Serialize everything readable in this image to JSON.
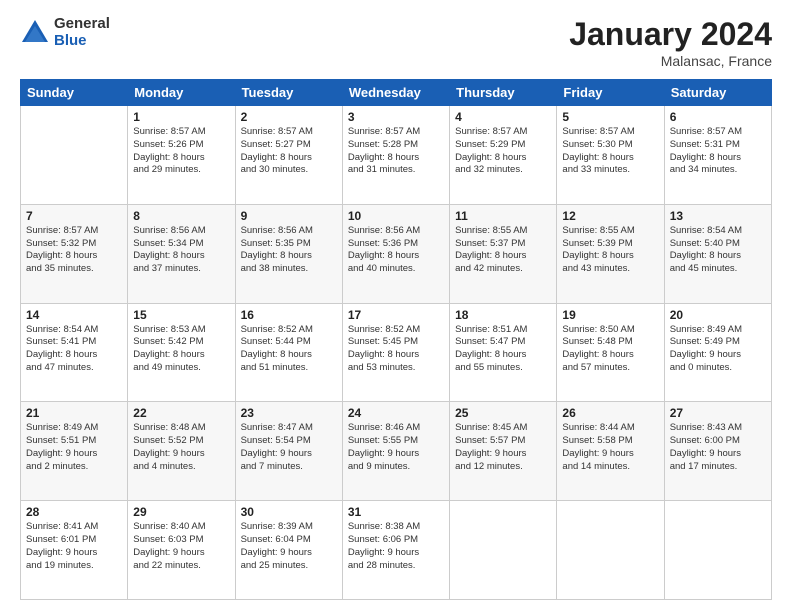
{
  "header": {
    "logo_general": "General",
    "logo_blue": "Blue",
    "title": "January 2024",
    "location": "Malansac, France"
  },
  "columns": [
    "Sunday",
    "Monday",
    "Tuesday",
    "Wednesday",
    "Thursday",
    "Friday",
    "Saturday"
  ],
  "weeks": [
    [
      {
        "day": "",
        "info": ""
      },
      {
        "day": "1",
        "info": "Sunrise: 8:57 AM\nSunset: 5:26 PM\nDaylight: 8 hours\nand 29 minutes."
      },
      {
        "day": "2",
        "info": "Sunrise: 8:57 AM\nSunset: 5:27 PM\nDaylight: 8 hours\nand 30 minutes."
      },
      {
        "day": "3",
        "info": "Sunrise: 8:57 AM\nSunset: 5:28 PM\nDaylight: 8 hours\nand 31 minutes."
      },
      {
        "day": "4",
        "info": "Sunrise: 8:57 AM\nSunset: 5:29 PM\nDaylight: 8 hours\nand 32 minutes."
      },
      {
        "day": "5",
        "info": "Sunrise: 8:57 AM\nSunset: 5:30 PM\nDaylight: 8 hours\nand 33 minutes."
      },
      {
        "day": "6",
        "info": "Sunrise: 8:57 AM\nSunset: 5:31 PM\nDaylight: 8 hours\nand 34 minutes."
      }
    ],
    [
      {
        "day": "7",
        "info": "Sunrise: 8:57 AM\nSunset: 5:32 PM\nDaylight: 8 hours\nand 35 minutes."
      },
      {
        "day": "8",
        "info": "Sunrise: 8:56 AM\nSunset: 5:34 PM\nDaylight: 8 hours\nand 37 minutes."
      },
      {
        "day": "9",
        "info": "Sunrise: 8:56 AM\nSunset: 5:35 PM\nDaylight: 8 hours\nand 38 minutes."
      },
      {
        "day": "10",
        "info": "Sunrise: 8:56 AM\nSunset: 5:36 PM\nDaylight: 8 hours\nand 40 minutes."
      },
      {
        "day": "11",
        "info": "Sunrise: 8:55 AM\nSunset: 5:37 PM\nDaylight: 8 hours\nand 42 minutes."
      },
      {
        "day": "12",
        "info": "Sunrise: 8:55 AM\nSunset: 5:39 PM\nDaylight: 8 hours\nand 43 minutes."
      },
      {
        "day": "13",
        "info": "Sunrise: 8:54 AM\nSunset: 5:40 PM\nDaylight: 8 hours\nand 45 minutes."
      }
    ],
    [
      {
        "day": "14",
        "info": "Sunrise: 8:54 AM\nSunset: 5:41 PM\nDaylight: 8 hours\nand 47 minutes."
      },
      {
        "day": "15",
        "info": "Sunrise: 8:53 AM\nSunset: 5:42 PM\nDaylight: 8 hours\nand 49 minutes."
      },
      {
        "day": "16",
        "info": "Sunrise: 8:52 AM\nSunset: 5:44 PM\nDaylight: 8 hours\nand 51 minutes."
      },
      {
        "day": "17",
        "info": "Sunrise: 8:52 AM\nSunset: 5:45 PM\nDaylight: 8 hours\nand 53 minutes."
      },
      {
        "day": "18",
        "info": "Sunrise: 8:51 AM\nSunset: 5:47 PM\nDaylight: 8 hours\nand 55 minutes."
      },
      {
        "day": "19",
        "info": "Sunrise: 8:50 AM\nSunset: 5:48 PM\nDaylight: 8 hours\nand 57 minutes."
      },
      {
        "day": "20",
        "info": "Sunrise: 8:49 AM\nSunset: 5:49 PM\nDaylight: 9 hours\nand 0 minutes."
      }
    ],
    [
      {
        "day": "21",
        "info": "Sunrise: 8:49 AM\nSunset: 5:51 PM\nDaylight: 9 hours\nand 2 minutes."
      },
      {
        "day": "22",
        "info": "Sunrise: 8:48 AM\nSunset: 5:52 PM\nDaylight: 9 hours\nand 4 minutes."
      },
      {
        "day": "23",
        "info": "Sunrise: 8:47 AM\nSunset: 5:54 PM\nDaylight: 9 hours\nand 7 minutes."
      },
      {
        "day": "24",
        "info": "Sunrise: 8:46 AM\nSunset: 5:55 PM\nDaylight: 9 hours\nand 9 minutes."
      },
      {
        "day": "25",
        "info": "Sunrise: 8:45 AM\nSunset: 5:57 PM\nDaylight: 9 hours\nand 12 minutes."
      },
      {
        "day": "26",
        "info": "Sunrise: 8:44 AM\nSunset: 5:58 PM\nDaylight: 9 hours\nand 14 minutes."
      },
      {
        "day": "27",
        "info": "Sunrise: 8:43 AM\nSunset: 6:00 PM\nDaylight: 9 hours\nand 17 minutes."
      }
    ],
    [
      {
        "day": "28",
        "info": "Sunrise: 8:41 AM\nSunset: 6:01 PM\nDaylight: 9 hours\nand 19 minutes."
      },
      {
        "day": "29",
        "info": "Sunrise: 8:40 AM\nSunset: 6:03 PM\nDaylight: 9 hours\nand 22 minutes."
      },
      {
        "day": "30",
        "info": "Sunrise: 8:39 AM\nSunset: 6:04 PM\nDaylight: 9 hours\nand 25 minutes."
      },
      {
        "day": "31",
        "info": "Sunrise: 8:38 AM\nSunset: 6:06 PM\nDaylight: 9 hours\nand 28 minutes."
      },
      {
        "day": "",
        "info": ""
      },
      {
        "day": "",
        "info": ""
      },
      {
        "day": "",
        "info": ""
      }
    ]
  ]
}
